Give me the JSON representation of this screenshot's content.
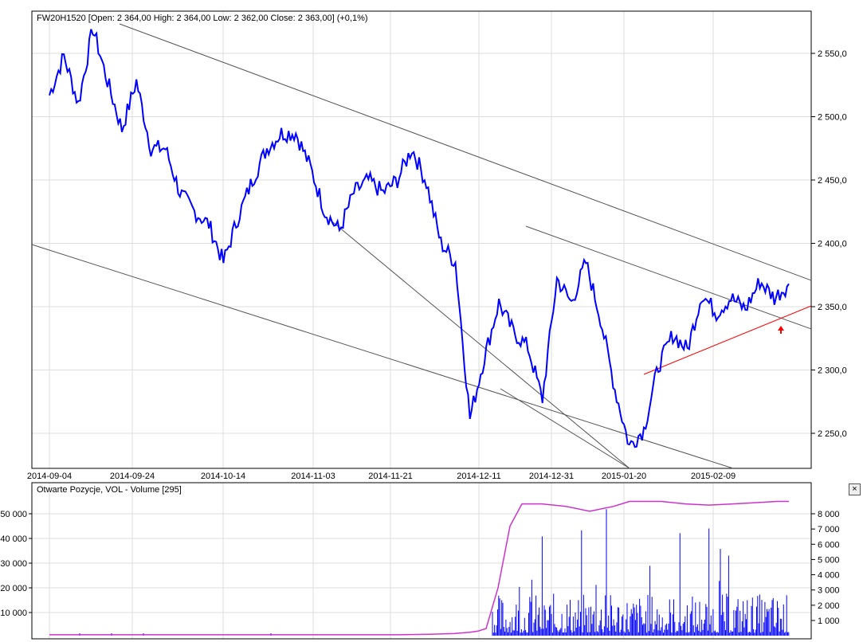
{
  "chart_data": [
    {
      "type": "line",
      "title": "FW20H1520 [Open: 2 364,00  High: 2 364,00  Low: 2 362,00  Close: 2 363,00] (+0,1%)",
      "ylim": [
        2220,
        2580
      ],
      "yticks": [
        {
          "v": 2550,
          "label": "2 550,0"
        },
        {
          "v": 2500,
          "label": "2 500,0"
        },
        {
          "v": 2450,
          "label": "2 450,0"
        },
        {
          "v": 2400,
          "label": "2 400,0"
        },
        {
          "v": 2350,
          "label": "2 350,0"
        },
        {
          "v": 2300,
          "label": "2 300,0"
        },
        {
          "v": 2250,
          "label": "2 250,0"
        }
      ],
      "xticks": [
        "2014-09-04",
        "2014-09-24",
        "2014-10-14",
        "2014-11-03",
        "2014-11-21",
        "2014-12-11",
        "2014-12-31",
        "2015-01-20",
        "2015-02-09"
      ],
      "series": [
        {
          "name": "FW20H1520",
          "color": "#0000ff",
          "values": [
            2517,
            2548,
            2510,
            2570,
            2528,
            2490,
            2528,
            2475,
            2475,
            2440,
            2425,
            2415,
            2385,
            2420,
            2450,
            2475,
            2487,
            2487,
            2460,
            2425,
            2410,
            2440,
            2450,
            2440,
            2450,
            2475,
            2448,
            2400,
            2385,
            2262,
            2310,
            2353,
            2330,
            2318,
            2277,
            2372,
            2353,
            2385,
            2341,
            2285,
            2240,
            2253,
            2303,
            2328,
            2316,
            2360,
            2345,
            2357,
            2348,
            2370,
            2357,
            2368
          ]
        }
      ],
      "trendlines": [
        {
          "color": "#555555"
        },
        {
          "color": "#555555"
        },
        {
          "color": "#555555"
        },
        {
          "color": "#555555"
        },
        {
          "color": "#555555"
        },
        {
          "color": "#ff0000"
        }
      ]
    },
    {
      "type": "bar",
      "title": "Otwarte Pozycje, VOL - Volume [295]",
      "left_yticks": [
        {
          "v": 50000,
          "label": "50 000"
        },
        {
          "v": 40000,
          "label": "40 000"
        },
        {
          "v": 30000,
          "label": "30 000"
        },
        {
          "v": 20000,
          "label": "20 000"
        },
        {
          "v": 10000,
          "label": "10 000"
        }
      ],
      "right_yticks": [
        {
          "v": 8000,
          "label": "8 000"
        },
        {
          "v": 7000,
          "label": "7 000"
        },
        {
          "v": 6000,
          "label": "6 000"
        },
        {
          "v": 5000,
          "label": "5 000"
        },
        {
          "v": 4000,
          "label": "4 000"
        },
        {
          "v": 3000,
          "label": "3 000"
        },
        {
          "v": 2000,
          "label": "2 000"
        },
        {
          "v": 1000,
          "label": "1 000"
        }
      ],
      "open_interest": {
        "color": "#cc33cc",
        "values": [
          1000,
          1000,
          1000,
          1200,
          1500,
          2000,
          2500,
          3500,
          20000,
          45000,
          54000,
          54000,
          53000,
          51000,
          53000,
          55000,
          55000,
          54000,
          53500,
          54000,
          54500,
          55000,
          55000
        ]
      },
      "volume": {
        "color": "#0000ff",
        "max": 8500
      }
    }
  ],
  "close_label": "×"
}
